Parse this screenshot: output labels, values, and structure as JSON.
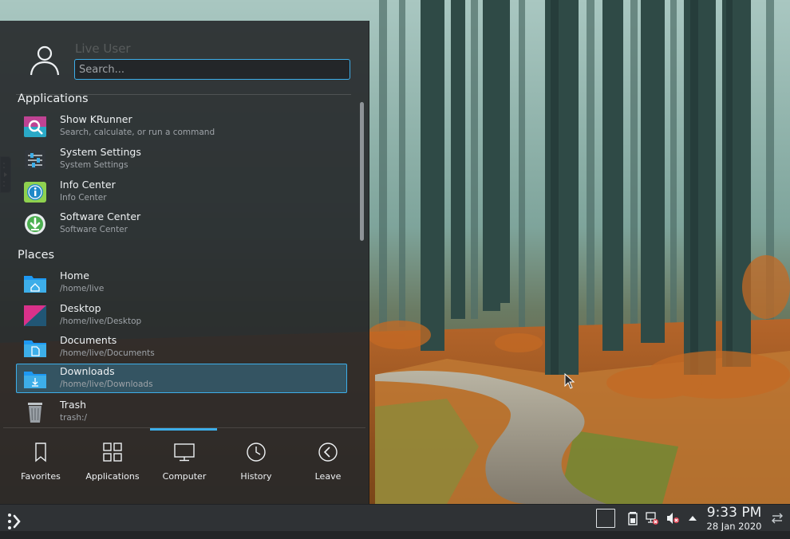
{
  "launcher": {
    "user_name": "Live User",
    "search_placeholder": "Search...",
    "sections": {
      "applications": "Applications",
      "places": "Places"
    },
    "applications": [
      {
        "label": "Show KRunner",
        "sublabel": "Search, calculate, or run a command",
        "icon": "krunner-icon"
      },
      {
        "label": "System Settings",
        "sublabel": "System Settings",
        "icon": "system-settings-icon"
      },
      {
        "label": "Info Center",
        "sublabel": "Info Center",
        "icon": "info-center-icon"
      },
      {
        "label": "Software Center",
        "sublabel": "Software Center",
        "icon": "software-center-icon"
      }
    ],
    "places": [
      {
        "label": "Home",
        "sublabel": "/home/live",
        "icon": "home-folder-icon"
      },
      {
        "label": "Desktop",
        "sublabel": "/home/live/Desktop",
        "icon": "desktop-folder-icon"
      },
      {
        "label": "Documents",
        "sublabel": "/home/live/Documents",
        "icon": "documents-folder-icon"
      },
      {
        "label": "Downloads",
        "sublabel": "/home/live/Downloads",
        "icon": "downloads-folder-icon",
        "selected": true
      },
      {
        "label": "Trash",
        "sublabel": "trash:/",
        "icon": "trash-icon"
      }
    ],
    "tabs": [
      {
        "label": "Favorites",
        "icon": "bookmark-icon"
      },
      {
        "label": "Applications",
        "icon": "grid-icon"
      },
      {
        "label": "Computer",
        "icon": "monitor-icon",
        "active": true
      },
      {
        "label": "History",
        "icon": "clock-icon"
      },
      {
        "label": "Leave",
        "icon": "chevron-left-circle-icon"
      }
    ]
  },
  "panel": {
    "clock": {
      "time": "9:33 PM",
      "date": "28 Jan 2020"
    },
    "tray_icons": [
      "show-desktop-icon",
      "battery-icon",
      "network-disconnected-icon",
      "volume-muted-icon",
      "expand-tray-arrow-icon",
      "panel-settings-icon"
    ]
  },
  "colors": {
    "accent": "#3daee9",
    "panel_bg": "#2f3235",
    "launcher_bg": "#26282a"
  }
}
